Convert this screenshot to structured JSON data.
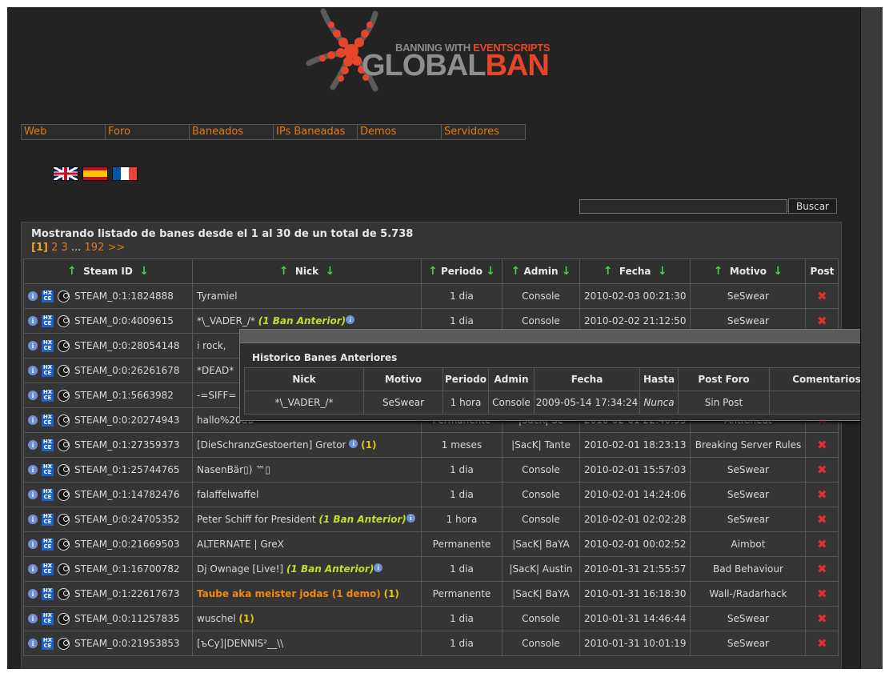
{
  "logo": {
    "top": "BANNING WITH ",
    "top_hl": "EVENTSCRIPTS",
    "main_a": "GLOBAL",
    "main_b": "BAN"
  },
  "nav": [
    "Web",
    "Foro",
    "Baneados",
    "IPs Baneadas",
    "Demos",
    "Servidores"
  ],
  "flags": [
    "uk-flag",
    "spain-flag",
    "france-flag"
  ],
  "search": {
    "value": "",
    "button": "Buscar"
  },
  "listing": {
    "title": "Mostrando listado de banes desde el 1 al 30 de un total de 5.738",
    "pager": {
      "current": "[1]",
      "p2": "2",
      "p3": "3",
      "dots": "...",
      "last": "192",
      "next": ">>"
    }
  },
  "columns": {
    "steam": "Steam ID",
    "nick": "Nick",
    "periodo": "Periodo",
    "admin": "Admin",
    "fecha": "Fecha",
    "motivo": "Motivo",
    "post": "Post"
  },
  "icon_names": {
    "info": "info-icon",
    "hlxce": "hlxce-icon",
    "steam": "steam-icon",
    "delete": "delete-icon",
    "sort": "sort-arrow-icon"
  },
  "colors": {
    "background": "#232323",
    "link": "#e07b12",
    "delete": "#e03030",
    "sort_arrow": "#46d046"
  },
  "rows": [
    {
      "steam": "STEAM_0:1:1824888",
      "nick": "Tyramiel",
      "note": "",
      "note_kind": "",
      "periodo": "1 dia",
      "admin": "Console",
      "fecha": "2010-02-03 00:21:30",
      "motivo": "SeSwear"
    },
    {
      "steam": "STEAM_0:0:4009615",
      "nick": "*\\_VADER_/*",
      "note": "(1 Ban Anterior)",
      "note_kind": "green",
      "periodo": "1 dia",
      "admin": "Console",
      "fecha": "2010-02-02 21:12:50",
      "motivo": "SeSwear"
    },
    {
      "steam": "STEAM_0:0:28054148",
      "nick": "i rock,",
      "note": "",
      "note_kind": "",
      "periodo": "",
      "admin": "",
      "fecha": "",
      "motivo": ""
    },
    {
      "steam": "STEAM_0:0:26261678",
      "nick": "*DEAD*",
      "note": "",
      "note_kind": "",
      "periodo": "",
      "admin": "",
      "fecha": "",
      "motivo": ""
    },
    {
      "steam": "STEAM_0:1:5663982",
      "nick": "-=SIFF=",
      "note": "",
      "note_kind": "",
      "periodo": "",
      "admin": "",
      "fecha": "",
      "motivo": ""
    },
    {
      "steam": "STEAM_0:0:20274943",
      "nick": "hallo%20du",
      "note": "",
      "note_kind": "",
      "periodo": "Permanente",
      "admin": "|SacK| Se",
      "fecha": "2010-02-01 22:40:53",
      "motivo": "AntiCheat"
    },
    {
      "steam": "STEAM_0:1:27359373",
      "nick": "[DieSchranzGestoerten] Gretor",
      "note": "(1)",
      "note_kind": "yellow-info",
      "periodo": "1 meses",
      "admin": "|SacK| Tante",
      "fecha": "2010-02-01 18:23:13",
      "motivo": "Breaking Server Rules"
    },
    {
      "steam": "STEAM_0:1:25744765",
      "nick": "NasenBär▯) ™▯",
      "note": "",
      "note_kind": "",
      "periodo": "1 dia",
      "admin": "Console",
      "fecha": "2010-02-01 15:57:03",
      "motivo": "SeSwear"
    },
    {
      "steam": "STEAM_0:1:14782476",
      "nick": "falaffelwaffel",
      "note": "",
      "note_kind": "",
      "periodo": "1 dia",
      "admin": "Console",
      "fecha": "2010-02-01 14:24:06",
      "motivo": "SeSwear"
    },
    {
      "steam": "STEAM_0:0:24705352",
      "nick": "Peter Schiff for President",
      "note": "(1 Ban Anterior)",
      "note_kind": "green",
      "periodo": "1 hora",
      "admin": "Console",
      "fecha": "2010-02-01 02:02:28",
      "motivo": "SeSwear"
    },
    {
      "steam": "STEAM_0:0:21669503",
      "nick": "ALTERNATE | GreX",
      "note": "",
      "note_kind": "",
      "periodo": "Permanente",
      "admin": "|SacK| BaYA",
      "fecha": "2010-02-01 00:02:52",
      "motivo": "Aimbot"
    },
    {
      "steam": "STEAM_0:1:16700782",
      "nick": "Dj Ownage [Live!]",
      "note": "(1 Ban Anterior)",
      "note_kind": "green",
      "periodo": "1 dia",
      "admin": "|SacK| Austin",
      "fecha": "2010-01-31 21:55:57",
      "motivo": "Bad Behaviour"
    },
    {
      "steam": "STEAM_0:1:22617673",
      "nick": "Taube aka meister jodas (1 demo)",
      "note": "(1)",
      "note_kind": "orange",
      "periodo": "Permanente",
      "admin": "|SacK| BaYA",
      "fecha": "2010-01-31 16:18:30",
      "motivo": "Wall-/Radarhack"
    },
    {
      "steam": "STEAM_0:0:11257835",
      "nick": "wuschel",
      "note": "(1)",
      "note_kind": "yellow",
      "periodo": "1 dia",
      "admin": "Console",
      "fecha": "2010-01-31 14:46:44",
      "motivo": "SeSwear"
    },
    {
      "steam": "STEAM_0:0:21953853",
      "nick": "[ъCy]|DENNIS²__\\\\",
      "note": "",
      "note_kind": "",
      "periodo": "1 dia",
      "admin": "Console",
      "fecha": "2010-01-31 10:01:19",
      "motivo": "SeSwear"
    }
  ],
  "popup": {
    "close": "x",
    "title": "Historico Banes Anteriores",
    "headers": [
      "Nick",
      "Motivo",
      "Periodo",
      "Admin",
      "Fecha",
      "Hasta",
      "Post Foro",
      "Comentarios"
    ],
    "row": [
      "*\\_VADER_/*",
      "SeSwear",
      "1 hora",
      "Console",
      "2009-05-14 17:34:24",
      "Nunca",
      "Sin Post",
      ""
    ]
  }
}
